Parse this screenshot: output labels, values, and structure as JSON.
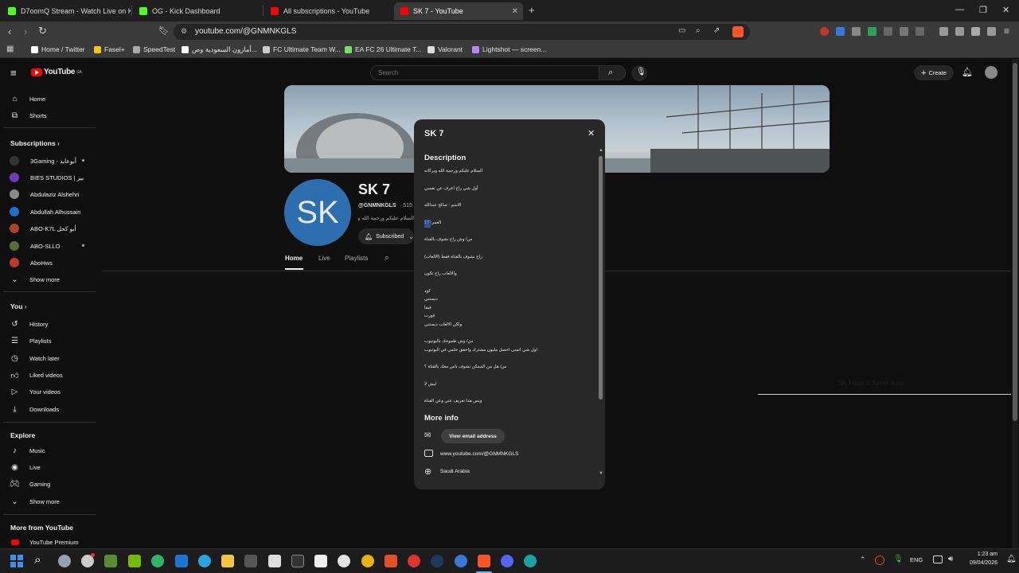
{
  "browser": {
    "tabs": [
      {
        "title": "D7oomQ Stream - Watch Live on Kick",
        "color": "#53fc18"
      },
      {
        "title": "OG - Kick Dashboard",
        "color": "#53fc18"
      },
      {
        "title": "All subscriptions - YouTube",
        "color": "#ff0000"
      },
      {
        "title": "SK 7 - YouTube",
        "color": "#ff0000"
      }
    ],
    "new_tab": "+",
    "url": "youtube.com/@GNMNKGLS",
    "bookmarks": [
      {
        "label": "Home / Twitter",
        "color": "#ffffff"
      },
      {
        "label": "Fasel+",
        "color": "#f5c518"
      },
      {
        "label": "SpeedTest",
        "color": "#aaaaaa"
      },
      {
        "label": "أمازون السعودية وص...",
        "color": "#ffffff"
      },
      {
        "label": "FC Ultimate Team W...",
        "color": "#cccccc"
      },
      {
        "label": "EA FC 26 Ultimate T...",
        "color": "#7ddc6f"
      },
      {
        "label": "Valorant",
        "color": "#dddddd"
      },
      {
        "label": "Lightshot — screen...",
        "color": "#b388ff"
      }
    ]
  },
  "youtube": {
    "logo": "YouTube",
    "logo_region": "SA",
    "search_placeholder": "Search",
    "create_label": "Create",
    "sidebar": {
      "top": [
        {
          "label": "Home",
          "icon": "home-icon"
        },
        {
          "label": "Shorts",
          "icon": "shorts-icon"
        }
      ],
      "subscriptions_heading": "Subscriptions",
      "subscriptions": [
        {
          "label": "3Gaming - أبوعابد",
          "color": "#333333",
          "dot": true
        },
        {
          "label": "BIES STUDIOS | بيز",
          "color": "#6a3fb5",
          "dot": false
        },
        {
          "label": "Abdulaziz Alshehri",
          "color": "#8a8a8a",
          "dot": false
        },
        {
          "label": "Abdullah Alhussain",
          "color": "#1f6fd1",
          "dot": false
        },
        {
          "label": "ABO-K7L أبو كحل",
          "color": "#b0402e",
          "dot": false
        },
        {
          "label": "ABO-SLLO",
          "color": "#5b6b3a",
          "dot": true
        },
        {
          "label": "AboHws",
          "color": "#c0392b",
          "dot": false
        }
      ],
      "show_more": "Show more",
      "you_heading": "You",
      "you": [
        {
          "label": "History",
          "icon": "history-icon"
        },
        {
          "label": "Playlists",
          "icon": "playlists-icon"
        },
        {
          "label": "Watch later",
          "icon": "watch-later-icon"
        },
        {
          "label": "Liked videos",
          "icon": "like-icon"
        },
        {
          "label": "Your videos",
          "icon": "your-videos-icon"
        },
        {
          "label": "Downloads",
          "icon": "download-icon"
        }
      ],
      "explore_heading": "Explore",
      "explore": [
        {
          "label": "Music",
          "icon": "music-icon"
        },
        {
          "label": "Live",
          "icon": "live-icon"
        },
        {
          "label": "Gaming",
          "icon": "gaming-icon"
        }
      ],
      "show_more_2": "Show more",
      "more_heading": "More from YouTube",
      "more": [
        {
          "label": "YouTube Premium",
          "icon": "youtube-premium-icon"
        }
      ]
    },
    "channel": {
      "avatar_text": "SK",
      "avatar_color": "#2d6fae",
      "name": "SK 7",
      "handle": "@GNMNKGLS",
      "subs_fragment": "· 515 s",
      "desc_fragment": "السلام عليكم ورحمة الله وبركاته",
      "subscribed_label": "Subscribed",
      "tabs": [
        "Home",
        "Live",
        "Playlists"
      ]
    },
    "modal": {
      "title": "SK 7",
      "description_heading": "Description",
      "description_lines": [
        "السلام عليكم ورحمة الله وبركاته",
        "أول شي راح اعرف عن نفسي",
        "الاسم : صالح عبدالله",
        "العمر: 17",
        "س/ وش راح نشوف بالقناة",
        "راح نشوف بالقناة فقط (الالعاب)",
        "والالعاب راح تكون",
        "كود",
        "ديستني",
        "فيفا",
        "فورت",
        "ولكن الالعاب ديستني",
        "س/ وش طموحك باليوتيوب",
        "اول شي اتمنى احصل مليون مشترك واحقق حلمي في اليوتيوب",
        "س/ هل من الممكن نشوف ناس معك بالقناة ؟",
        "ليش لا",
        "وبس هذا تعريف عني وعن القناة"
      ],
      "more_info_heading": "More info",
      "view_email_label": "View email address",
      "channel_url": "www.youtube.com/@GNMNKGLS",
      "country": "Saudi Arabia"
    },
    "background_ghost_text": "SK Funeral Saves Area"
  },
  "taskbar": {
    "lang": "ENG",
    "time": "1:23 am",
    "date": "09/04/2026",
    "icons": [
      {
        "name": "windows-start-icon",
        "color": "#3b8eea"
      },
      {
        "name": "search-icon",
        "color": "#ffffff"
      },
      {
        "name": "settings-icon",
        "color": "#9aa0a6"
      },
      {
        "name": "chatgpt-icon",
        "color": "#cccccc"
      },
      {
        "name": "minecraft-icon",
        "color": "#5b8c32"
      },
      {
        "name": "nvidia-icon",
        "color": "#76b900"
      },
      {
        "name": "edge-icon",
        "color": "#2fb56a"
      },
      {
        "name": "outlook-icon",
        "color": "#1e74d2"
      },
      {
        "name": "telegram-icon",
        "color": "#2aa3df"
      },
      {
        "name": "file-explorer-icon",
        "color": "#f5c542"
      },
      {
        "name": "keyboard-app-icon",
        "color": "#555555"
      },
      {
        "name": "game-controller-icon",
        "color": "#dddddd"
      },
      {
        "name": "epic-games-icon",
        "color": "#333333"
      },
      {
        "name": "capcut-icon",
        "color": "#eeeeee"
      },
      {
        "name": "g-app-icon",
        "color": "#e5e5e5"
      },
      {
        "name": "chrome-icon",
        "color": "#e8b30b"
      },
      {
        "name": "brave-alt-icon",
        "color": "#e34f26"
      },
      {
        "name": "red-app-icon",
        "color": "#d33"
      },
      {
        "name": "steam-icon",
        "color": "#1b3a5c"
      },
      {
        "name": "blue-app-icon",
        "color": "#3a78d6"
      },
      {
        "name": "brave-icon",
        "color": "#fb542b"
      },
      {
        "name": "discord-icon",
        "color": "#5865f2"
      },
      {
        "name": "teal-app-icon",
        "color": "#1aa1a1"
      }
    ]
  }
}
